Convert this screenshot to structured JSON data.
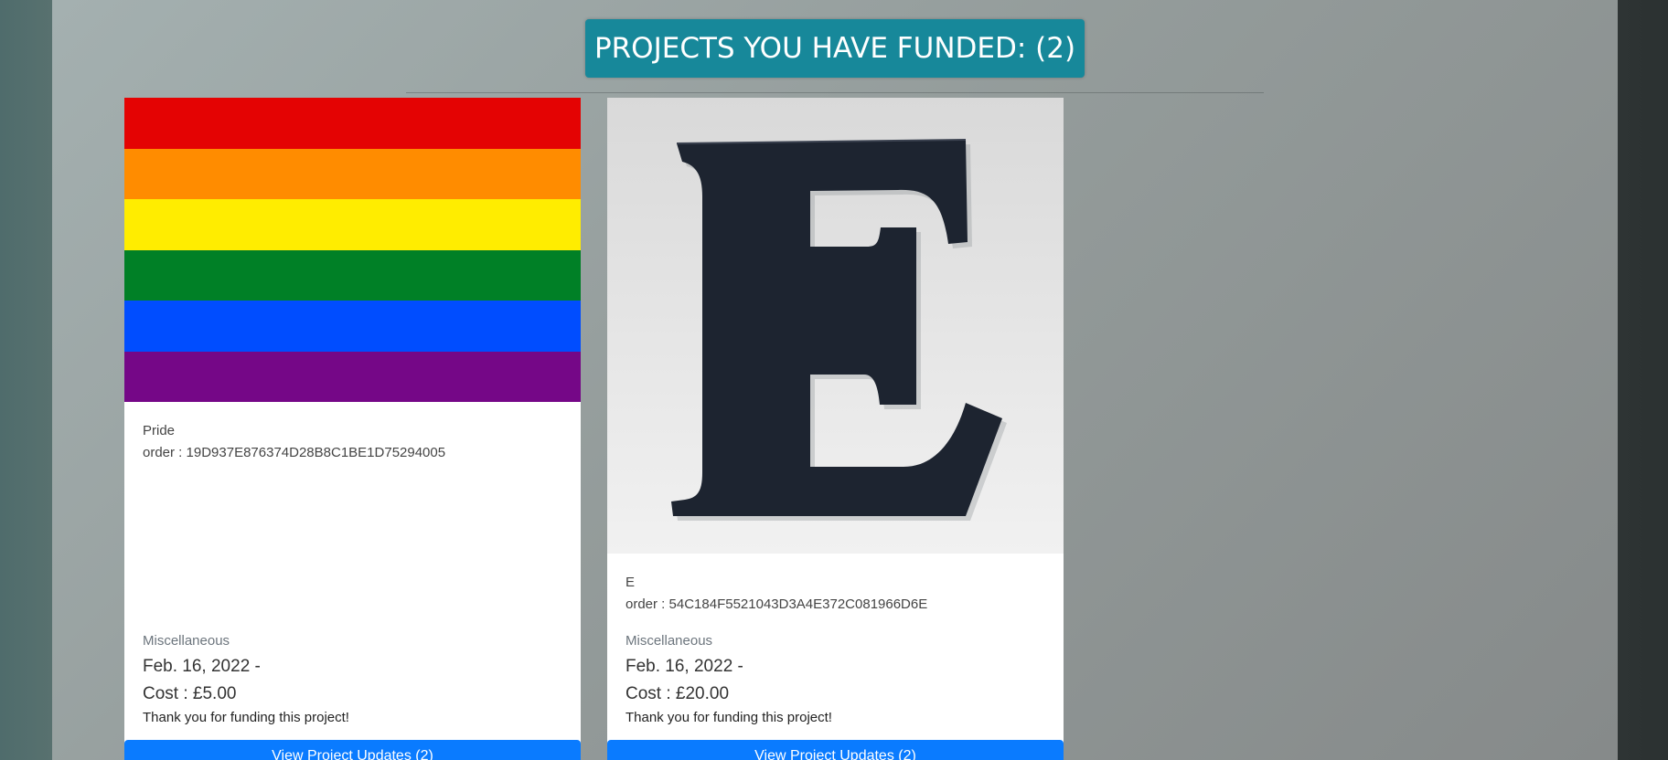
{
  "heading": "PROJECTS YOU HAVE FUNDED: (2)",
  "colors": {
    "heading_bg": "#17889a",
    "button_bg": "#0a7bff"
  },
  "projects": [
    {
      "image": "rainbow-pride-flag",
      "flag_colors": [
        "#e40303",
        "#ff8c00",
        "#ffed00",
        "#008026",
        "#004dff",
        "#750787"
      ],
      "title": "Pride",
      "order": "order : 19D937E876374D28B8C1BE1D75294005",
      "category": "Miscellaneous",
      "date": "Feb. 16, 2022 -",
      "cost": "Cost : £5.00",
      "thanks": "Thank you for funding this project!",
      "button": "View Project Updates (2)"
    },
    {
      "image": "letter-e-photo",
      "title": "E",
      "order": "order : 54C184F5521043D3A4E372C081966D6E",
      "category": "Miscellaneous",
      "date": "Feb. 16, 2022 -",
      "cost": "Cost : £20.00",
      "thanks": "Thank you for funding this project!",
      "button": "View Project Updates (2)"
    }
  ]
}
